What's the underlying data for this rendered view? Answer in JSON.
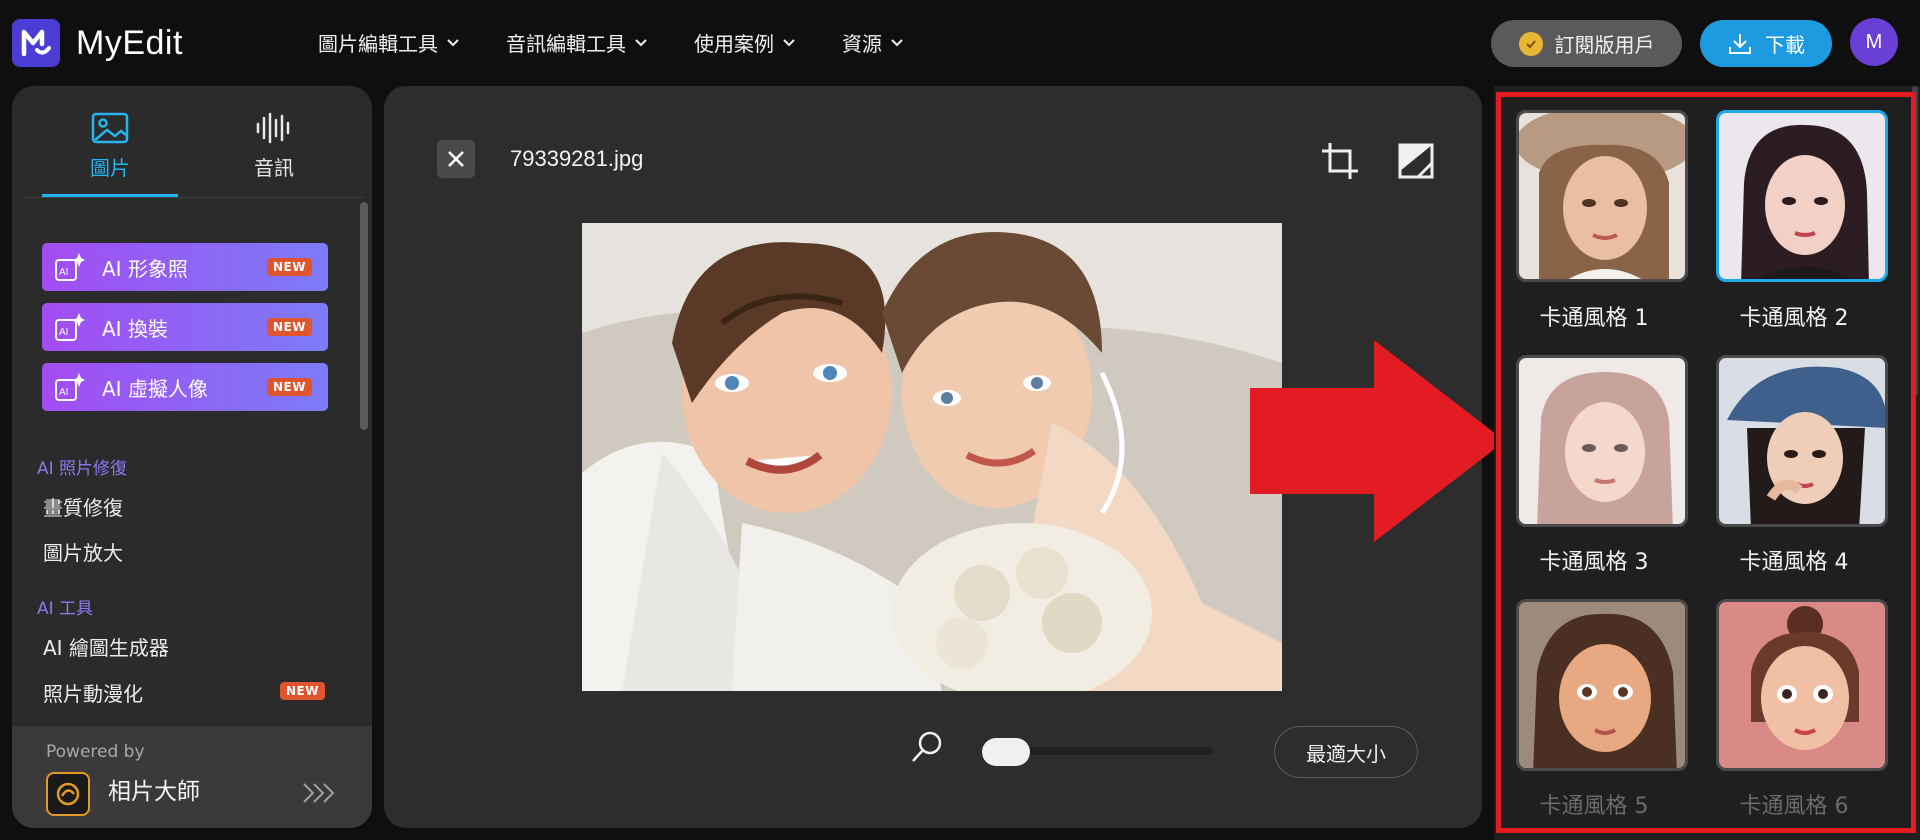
{
  "app": {
    "name": "MyEdit"
  },
  "nav": [
    {
      "label": "圖片編輯工具"
    },
    {
      "label": "音訊編輯工具"
    },
    {
      "label": "使用案例"
    },
    {
      "label": "資源"
    }
  ],
  "header": {
    "subscribe_label": "訂閱版用戶",
    "download_label": "下載",
    "avatar_initial": "M"
  },
  "sidebar": {
    "tabs": [
      {
        "label": "圖片"
      },
      {
        "label": "音訊"
      }
    ],
    "ai_buttons": [
      {
        "label": "AI 形象照",
        "badge": "NEW"
      },
      {
        "label": "AI 換裝",
        "badge": "NEW"
      },
      {
        "label": "AI 虛擬人像",
        "badge": "NEW"
      }
    ],
    "sections": [
      {
        "heading": "AI 照片修復",
        "items": [
          {
            "label": "畫質修復"
          },
          {
            "label": "圖片放大"
          }
        ]
      },
      {
        "heading": "AI 工具",
        "items": [
          {
            "label": "AI 繪圖生成器"
          },
          {
            "label": "照片動漫化",
            "badge": "NEW"
          }
        ]
      }
    ],
    "powered_by": "Powered by",
    "product_name": "相片大師"
  },
  "editor": {
    "file_name": "79339281.jpg",
    "fit_label": "最適大小",
    "zoom_fraction": 0
  },
  "styles": [
    {
      "label": "卡通風格 1",
      "selected": false
    },
    {
      "label": "卡通風格 2",
      "selected": true
    },
    {
      "label": "卡通風格 3",
      "selected": false
    },
    {
      "label": "卡通風格 4",
      "selected": false
    },
    {
      "label": "卡通風格 5",
      "selected": false
    },
    {
      "label": "卡通風格 6",
      "selected": false
    }
  ],
  "colors": {
    "accent": "#25b4ee",
    "download": "#1e9be0",
    "ai_gradient_start": "#a34bf2",
    "ai_gradient_end": "#7c7cf7",
    "new_badge": "#e0552d",
    "highlight": "#e31b23"
  },
  "icons": {
    "logo": "myedit-logo-icon",
    "subscribe": "coin-icon",
    "download": "download-icon",
    "image_tab": "image-icon",
    "audio_tab": "waveform-icon",
    "close": "close-icon",
    "crop": "crop-icon",
    "compare": "compare-icon",
    "zoom": "search-icon",
    "annotation": "red-arrow-icon"
  }
}
